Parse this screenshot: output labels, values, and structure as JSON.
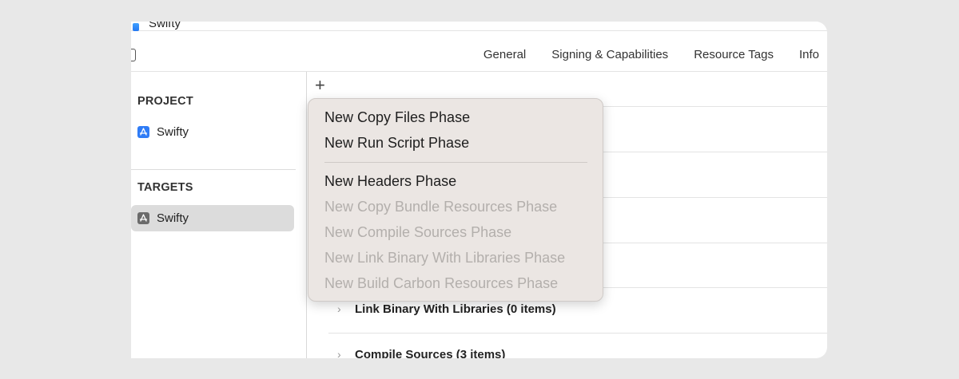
{
  "window": {
    "title": "Swifty"
  },
  "tabs": [
    {
      "label": "General"
    },
    {
      "label": "Signing & Capabilities"
    },
    {
      "label": "Resource Tags"
    },
    {
      "label": "Info"
    }
  ],
  "sidebar": {
    "project_header": "PROJECT",
    "project_item": {
      "label": "Swifty",
      "icon": "app-store-icon"
    },
    "targets_header": "TARGETS",
    "target_item": {
      "label": "Swifty",
      "icon": "app-target-icon",
      "selected": true
    }
  },
  "main": {
    "add_label": "+",
    "phases": [
      {
        "label": "Link Binary With Libraries (0 items)"
      },
      {
        "label": "Compile Sources (3 items)"
      }
    ]
  },
  "menu": {
    "items": [
      {
        "label": "New Copy Files Phase",
        "enabled": true
      },
      {
        "label": "New Run Script Phase",
        "enabled": true
      },
      {
        "label": "New Headers Phase",
        "enabled": true
      },
      {
        "label": "New Copy Bundle Resources Phase",
        "enabled": false
      },
      {
        "label": "New Compile Sources Phase",
        "enabled": false
      },
      {
        "label": "New Link Binary With Libraries Phase",
        "enabled": false
      },
      {
        "label": "New Build Carbon Resources Phase",
        "enabled": false
      }
    ]
  },
  "colors": {
    "background": "#e8e8e8",
    "menu_background": "#ebe6e3",
    "project_icon": "#2f7cf6",
    "target_icon": "#6b6b6b",
    "selection": "#dcdcdc"
  }
}
